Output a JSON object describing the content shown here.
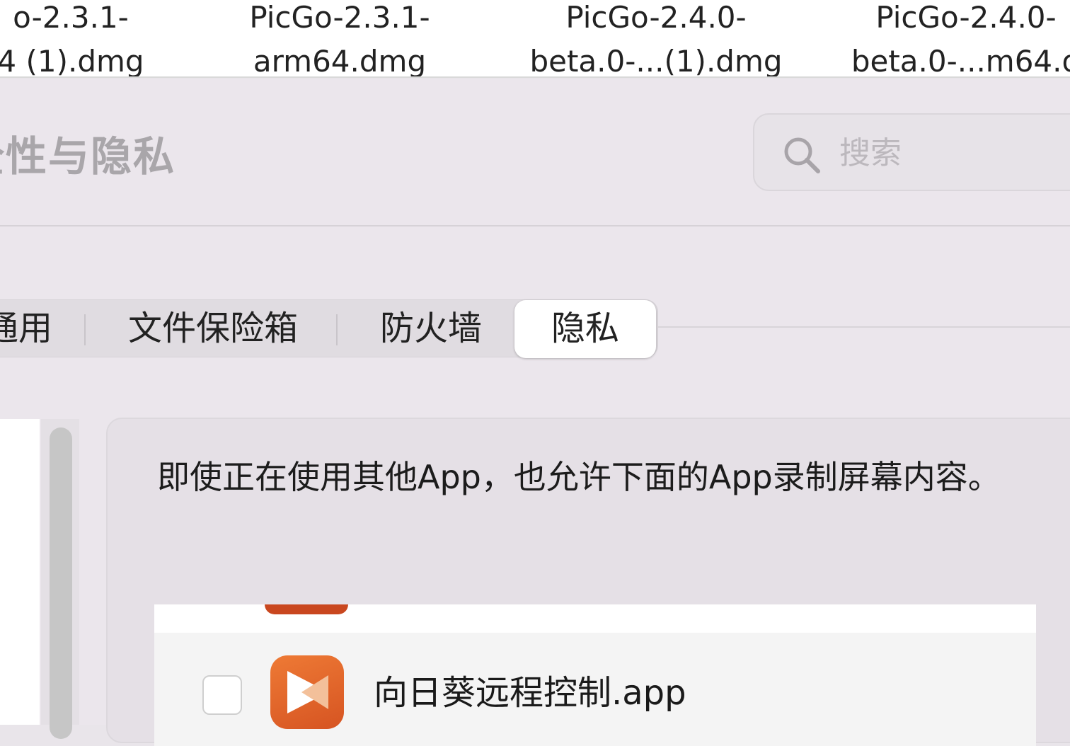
{
  "finder": {
    "files": [
      {
        "line1": "o-2.3.1-",
        "line2": "4 (1).dmg"
      },
      {
        "line1": "PicGo-2.3.1-",
        "line2": "arm64.dmg"
      },
      {
        "line1": "PicGo-2.4.0-",
        "line2": "beta.0-...(1).dmg"
      },
      {
        "line1": "PicGo-2.4.0-",
        "line2": "beta.0-...m64.d"
      }
    ]
  },
  "window": {
    "title": "全性与隐私",
    "search": {
      "placeholder": "搜索",
      "icon": "search-icon"
    }
  },
  "tabs": [
    {
      "label": "通用",
      "selected": false
    },
    {
      "label": "文件保险箱",
      "selected": false
    },
    {
      "label": "防火墙",
      "selected": false
    },
    {
      "label": "隐私",
      "selected": true
    }
  ],
  "panel": {
    "description": "即使正在使用其他App，也允许下面的App录制屏幕内容。",
    "apps": [
      {
        "name": "向日葵远程控制.app",
        "checked": false,
        "icon": "sunlogin-icon"
      }
    ]
  },
  "colors": {
    "window_bg": "#ebe6ec",
    "selected_tab": "#ffffff",
    "app_icon_accent": "#e8692c"
  }
}
